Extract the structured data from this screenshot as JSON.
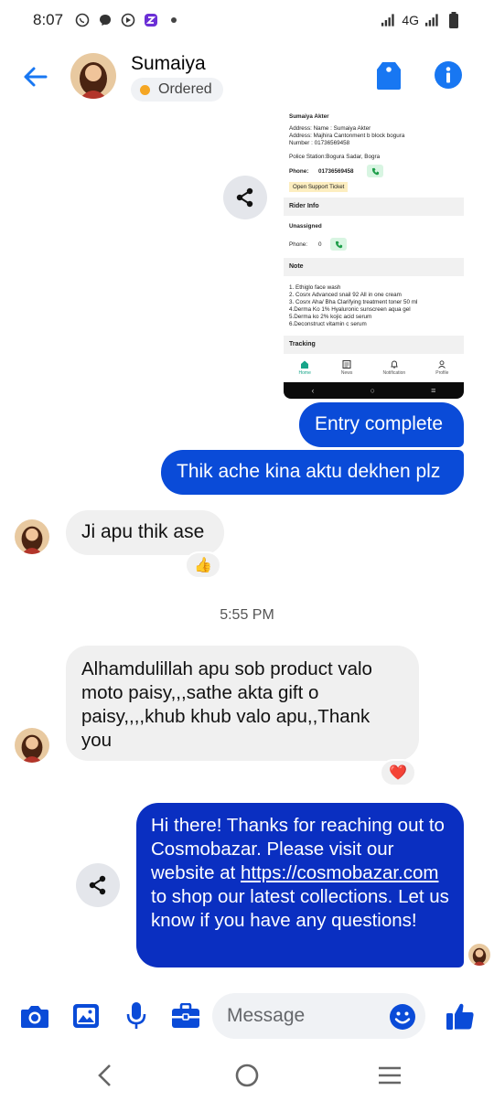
{
  "status_bar": {
    "time": "8:07",
    "network": "4G"
  },
  "header": {
    "contact_name": "Sumaiya",
    "status_label": "Ordered"
  },
  "shared_screenshot": {
    "name_heading": "Sumaiya Akter",
    "address_name": "Address: Name : Sumaiya Akter",
    "address_line": "Address: Majhira Cantonment b block bogura",
    "number_line": "Number : 01736569458",
    "police_station": "Police Station:Bogura Sadar, Bogra",
    "phone_label": "Phone:",
    "phone_number": "01736569458",
    "support_ticket": "Open Support Ticket",
    "rider_heading": "Rider Info",
    "rider_status": "Unassigned",
    "rider_phone_label": "Phone:",
    "rider_phone_value": "0",
    "note_heading": "Note",
    "notes": [
      "1. Ethiglo face wash",
      "2. Cosrx Advanced snail 92 All in one cream",
      "3. Cosrx Aha/ Bha Clarifying treatment toner 50 ml",
      "4.Derma Ko 1% Hyaluronic sunscreen aqua gel",
      "5.Derma ko 2% kojic acid serum",
      "6.Deconstruct vitamin c serum"
    ],
    "tracking_heading": "Tracking",
    "tabs": [
      "Home",
      "News",
      "Notification",
      "Profile"
    ]
  },
  "messages": {
    "out_1": "Entry complete",
    "out_2": "Thik ache kina aktu dekhen plz",
    "in_1": "Ji apu thik ase",
    "in_1_reaction": "👍",
    "timestamp": "5:55 PM",
    "in_2": "Alhamdulillah apu sob product valo moto paisy,,,sathe akta gift o paisy,,,,khub khub valo apu,,Thank you",
    "in_2_reaction": "❤️",
    "out_3_before": "Hi there! Thanks for reaching out to Cosmobazar. Please visit our website at ",
    "out_3_link": "https://cosmobazar.com",
    "out_3_after": " to shop our latest collections. Let us know if you have any questions!"
  },
  "composer": {
    "placeholder": "Message"
  },
  "colors": {
    "accent": "#0a4bd8",
    "bot_bubble": "#0a2fc1",
    "header_icons": "#1877f2"
  }
}
